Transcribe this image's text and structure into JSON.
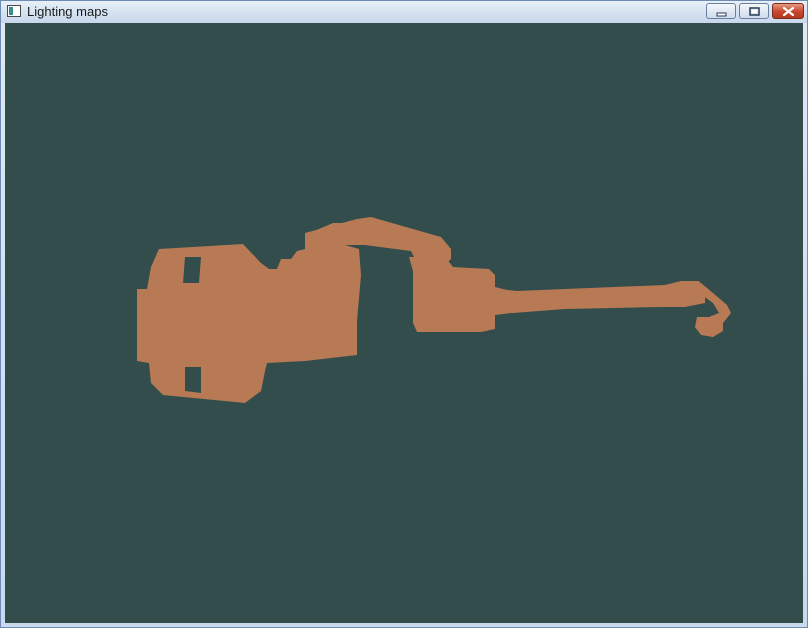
{
  "window": {
    "title": "Lighting maps",
    "icon": "app-window-icon",
    "controls": {
      "minimize_icon": "minimize-icon",
      "maximize_icon": "maximize-icon",
      "close_icon": "close-icon"
    }
  },
  "scene": {
    "clear_color": "#334d4d",
    "object_color": "#b87a55",
    "object": "robotic-arm-model"
  }
}
